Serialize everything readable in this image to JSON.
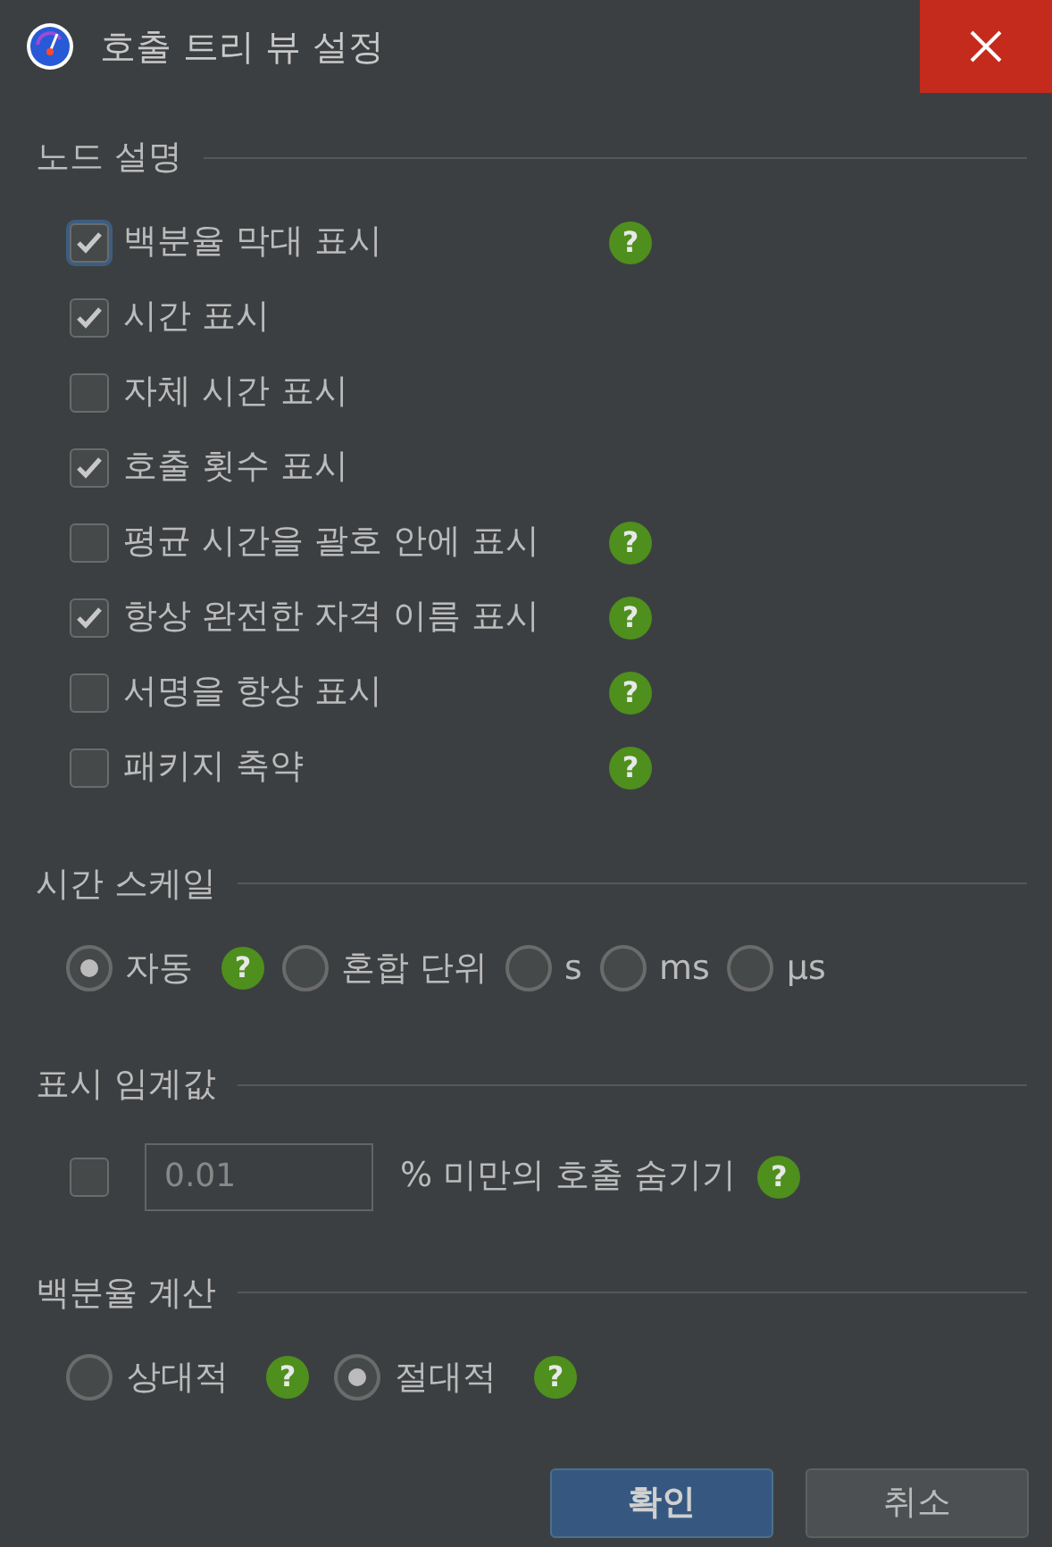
{
  "window": {
    "title": "호출 트리 뷰 설정"
  },
  "node_description": {
    "heading": "노드 설명",
    "options": [
      {
        "label": "백분율 막대 표시",
        "checked": true,
        "focused": true,
        "help": "?"
      },
      {
        "label": "시간 표시",
        "checked": true,
        "focused": false
      },
      {
        "label": "자체 시간 표시",
        "checked": false,
        "focused": false
      },
      {
        "label": "호출 횟수 표시",
        "checked": true,
        "focused": false
      },
      {
        "label": "평균 시간을 괄호 안에 표시",
        "checked": false,
        "focused": false,
        "help": "?"
      },
      {
        "label": "항상 완전한 자격 이름 표시",
        "checked": true,
        "focused": false,
        "help": "?"
      },
      {
        "label": "서명을 항상 표시",
        "checked": false,
        "focused": false,
        "help": "?"
      },
      {
        "label": "패키지 축약",
        "checked": false,
        "focused": false,
        "help": "?"
      }
    ]
  },
  "time_scale": {
    "heading": "시간 스케일",
    "options": [
      {
        "label": "자동",
        "selected": true,
        "help": "?"
      },
      {
        "label": "혼합 단위",
        "selected": false
      },
      {
        "label": "s",
        "selected": false
      },
      {
        "label": "ms",
        "selected": false
      },
      {
        "label": "µs",
        "selected": false
      }
    ]
  },
  "display_threshold": {
    "heading": "표시 임계값",
    "checked": false,
    "placeholder": "0.01",
    "label": "% 미만의 호출 숨기기",
    "help": "?"
  },
  "percentage_calculation": {
    "heading": "백분율 계산",
    "options": [
      {
        "label": "상대적",
        "selected": false,
        "help": "?"
      },
      {
        "label": "절대적",
        "selected": true,
        "help": "?"
      }
    ]
  },
  "buttons": [
    {
      "label": "확인",
      "kind": "primary"
    },
    {
      "label": "취소",
      "kind": "secondary"
    }
  ]
}
